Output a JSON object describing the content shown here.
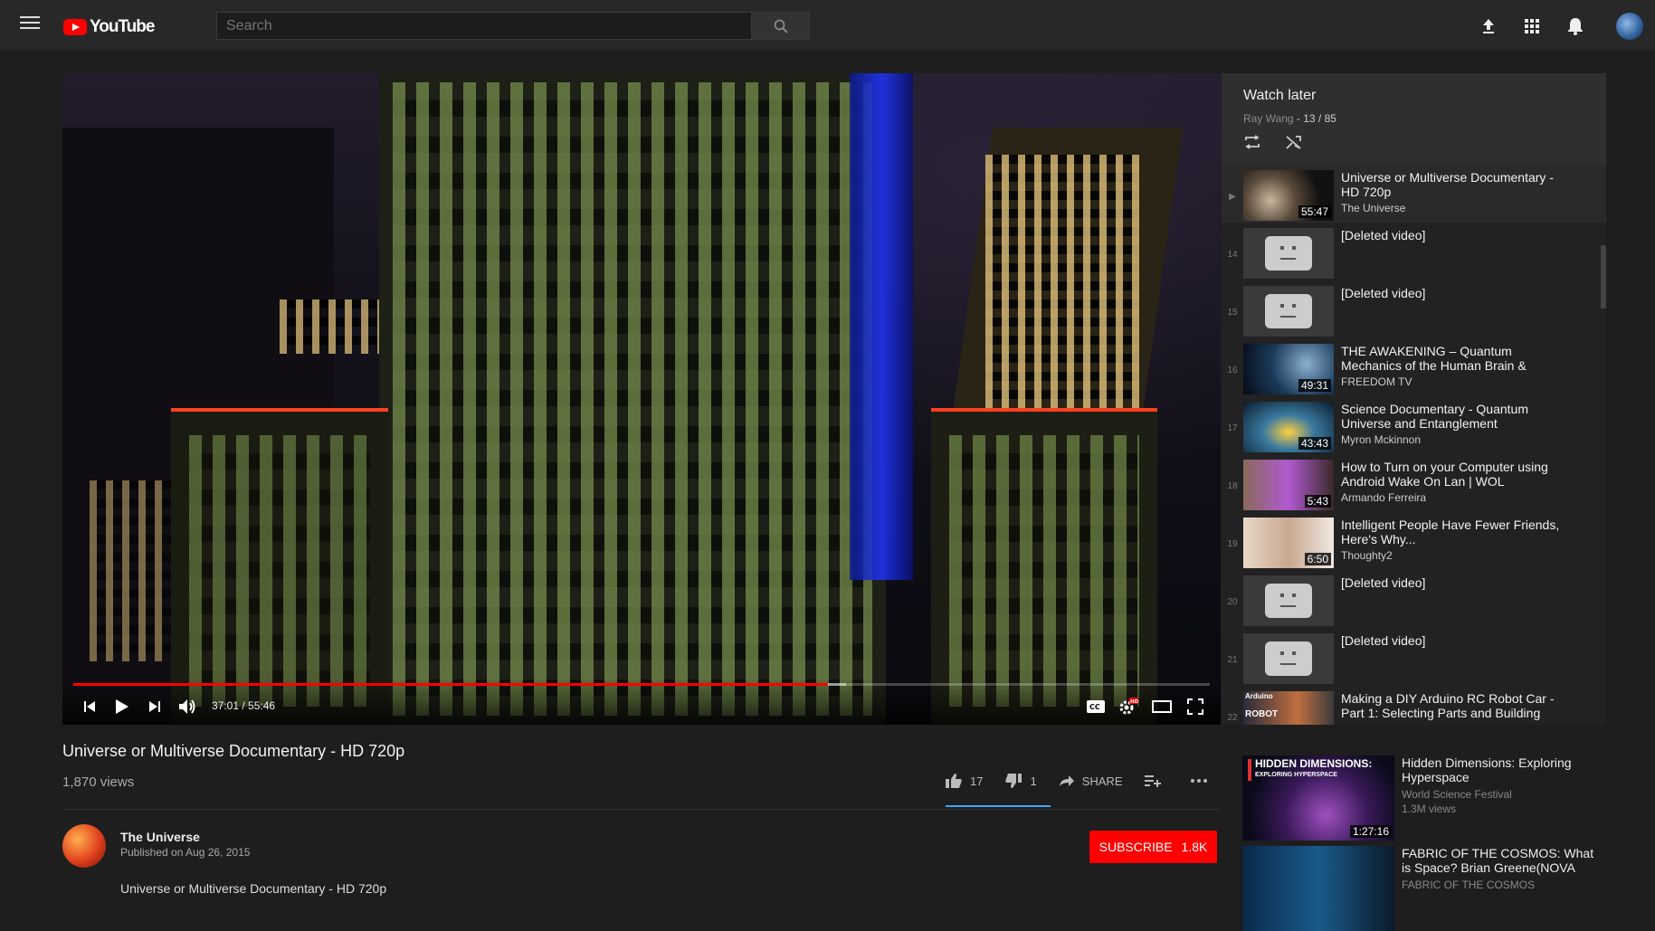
{
  "header": {
    "logo_text": "YouTube",
    "search_placeholder": "Search"
  },
  "player": {
    "current_time": "37:01",
    "duration": "55:46",
    "time_display": "37:01 / 55:46",
    "progress_fraction": 0.664,
    "buffered_fraction": 0.68
  },
  "playlist": {
    "title": "Watch later",
    "owner": "Ray Wang",
    "position": "- 13 / 85",
    "items": [
      {
        "index": "▶",
        "title": "Universe or Multiverse Documentary - HD 720p",
        "channel": "The Universe",
        "duration": "55:47",
        "deleted": false
      },
      {
        "index": "14",
        "title": "[Deleted video]",
        "channel": "",
        "duration": "",
        "deleted": true
      },
      {
        "index": "15",
        "title": "[Deleted video]",
        "channel": "",
        "duration": "",
        "deleted": true
      },
      {
        "index": "16",
        "title": "THE AWAKENING – Quantum Mechanics of the Human Brain &",
        "channel": "FREEDOM TV",
        "duration": "49:31",
        "deleted": false
      },
      {
        "index": "17",
        "title": "Science Documentary - Quantum Universe and Entanglement",
        "channel": "Myron Mckinnon",
        "duration": "43:43",
        "deleted": false
      },
      {
        "index": "18",
        "title": "How to Turn on your Computer using Android Wake On Lan | WOL",
        "channel": "Armando Ferreira",
        "duration": "5:43",
        "deleted": false
      },
      {
        "index": "19",
        "title": "Intelligent People Have Fewer Friends, Here's Why...",
        "channel": "Thoughty2",
        "duration": "6:50",
        "deleted": false
      },
      {
        "index": "20",
        "title": "[Deleted video]",
        "channel": "",
        "duration": "",
        "deleted": true
      },
      {
        "index": "21",
        "title": "[Deleted video]",
        "channel": "",
        "duration": "",
        "deleted": true
      },
      {
        "index": "22",
        "title": "Making a DIY Arduino RC Robot Car - Part 1: Selecting Parts and Building",
        "channel": "",
        "duration": "",
        "deleted": false
      }
    ]
  },
  "video": {
    "title": "Universe or Multiverse Documentary - HD 720p",
    "views": "1,870 views",
    "likes": "17",
    "dislikes": "1",
    "share_label": "SHARE",
    "channel": "The Universe",
    "published": "Published on Aug 26, 2015",
    "subscribe_label": "SUBSCRIBE",
    "subscriber_count": "1.8K",
    "description": "Universe or Multiverse Documentary - HD 720p"
  },
  "related": [
    {
      "title": "Hidden Dimensions: Exploring Hyperspace",
      "channel": "World Science Festival",
      "views": "1.3M views",
      "duration": "1:27:16",
      "thumb_text": "HIDDEN DIMENSIONS:",
      "thumb_subtext": "EXPLORING HYPERSPACE"
    },
    {
      "title": "FABRIC OF THE COSMOS: What is Space? Brian Greene(NOVA",
      "channel": "FABRIC OF THE COSMOS",
      "views": "",
      "duration": "",
      "thumb_text": "",
      "thumb_subtext": ""
    }
  ],
  "thumb_labels": {
    "arduino": "Arduino",
    "robot": "ROBOT"
  },
  "colors": {
    "accent_red": "#ff0000",
    "like_bar": "#3ea6ff",
    "background": "#1e1e1e"
  }
}
